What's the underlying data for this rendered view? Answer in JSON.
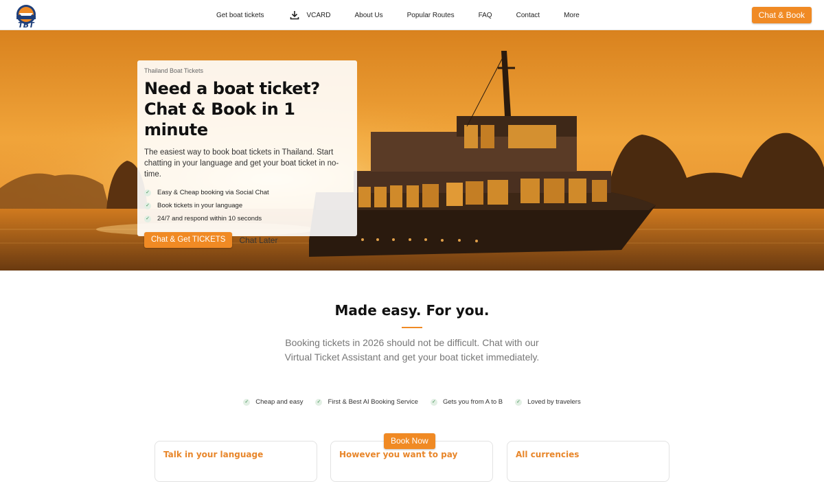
{
  "header": {
    "logo_text": "TBT",
    "nav": [
      {
        "label": "Get boat tickets"
      },
      {
        "label": "VCARD",
        "icon": "download-icon"
      },
      {
        "label": "About Us"
      },
      {
        "label": "Popular Routes"
      },
      {
        "label": "FAQ"
      },
      {
        "label": "Contact"
      },
      {
        "label": "More"
      }
    ],
    "cta_label": "Chat & Book"
  },
  "hero": {
    "eyebrow": "Thailand Boat Tickets",
    "title_line1": "Need a boat ticket?",
    "title_line2": "Chat & Book in 1 minute",
    "description": "The easiest way to book boat tickets in Thailand. Start chatting in your language and get your boat ticket in no-time.",
    "features": [
      "Easy & Cheap booking via Social Chat",
      "Book tickets in your language",
      "24/7 and respond within 10 seconds"
    ],
    "primary_button": "Chat & Get TICKETS",
    "secondary_button": "Chat Later"
  },
  "section": {
    "title": "Made easy. For you.",
    "subtitle": "Booking tickets in 2026 should not be difficult. Chat with our Virtual Ticket Assistant and get your boat ticket immediately.",
    "perks": [
      "Cheap and easy",
      "First & Best AI Booking Service",
      "Gets you from A to B",
      "Loved by travelers"
    ]
  },
  "cards": [
    {
      "title": "Talk in your language"
    },
    {
      "title": "However you want to pay"
    },
    {
      "title": "All currencies"
    }
  ],
  "floating_button": "Book Now",
  "colors": {
    "accent": "#f08a24",
    "card_title": "#e8862a",
    "check_green": "#3a8f4f"
  }
}
